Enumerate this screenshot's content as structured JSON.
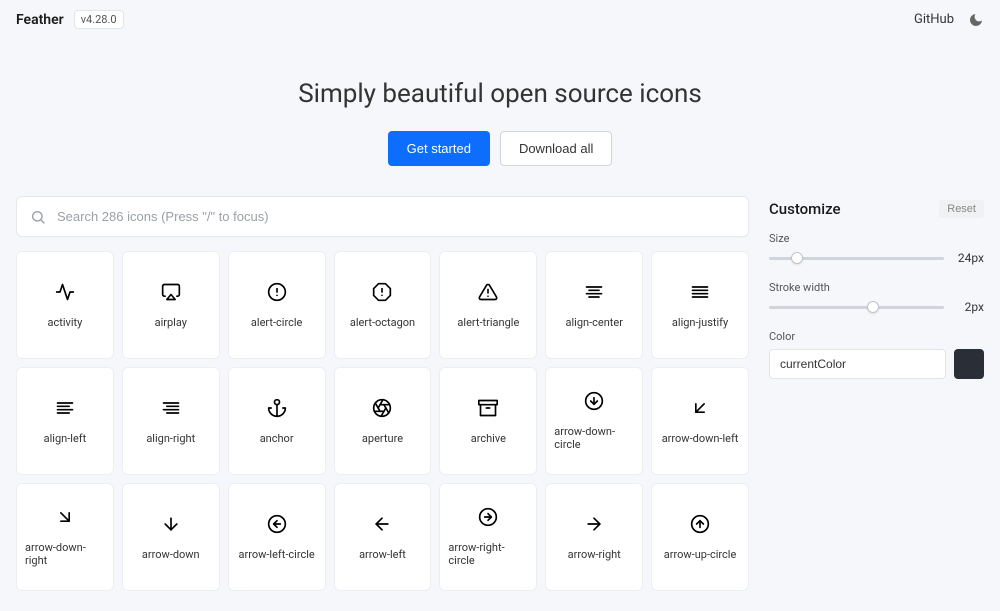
{
  "header": {
    "brand": "Feather",
    "version": "v4.28.0",
    "github": "GitHub"
  },
  "hero": {
    "tagline": "Simply beautiful open source icons",
    "primary": "Get started",
    "secondary": "Download all"
  },
  "search": {
    "placeholder": "Search 286 icons (Press \"/\" to focus)"
  },
  "customize": {
    "title": "Customize",
    "reset": "Reset",
    "size_label": "Size",
    "size_value": "24px",
    "stroke_label": "Stroke width",
    "stroke_value": "2px",
    "color_label": "Color",
    "color_value": "currentColor",
    "swatch_hex": "#2a2e36"
  },
  "icons": [
    {
      "name": "activity"
    },
    {
      "name": "airplay"
    },
    {
      "name": "alert-circle"
    },
    {
      "name": "alert-octagon"
    },
    {
      "name": "alert-triangle"
    },
    {
      "name": "align-center"
    },
    {
      "name": "align-justify"
    },
    {
      "name": "align-left"
    },
    {
      "name": "align-right"
    },
    {
      "name": "anchor"
    },
    {
      "name": "aperture"
    },
    {
      "name": "archive"
    },
    {
      "name": "arrow-down-circle"
    },
    {
      "name": "arrow-down-left"
    },
    {
      "name": "arrow-down-right"
    },
    {
      "name": "arrow-down"
    },
    {
      "name": "arrow-left-circle"
    },
    {
      "name": "arrow-left"
    },
    {
      "name": "arrow-right-circle"
    },
    {
      "name": "arrow-right"
    },
    {
      "name": "arrow-up-circle"
    }
  ]
}
